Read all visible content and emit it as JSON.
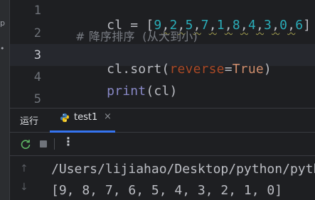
{
  "left_strip": {
    "glyphs": [
      "p",
      "•"
    ]
  },
  "editor": {
    "line_numbers": [
      "1",
      "2",
      "3",
      "4",
      "5"
    ],
    "active_line": "3",
    "lines": {
      "l1_prefix": "cl = [",
      "l1_numbers": [
        "9",
        "2",
        "5",
        "7",
        "1",
        "8",
        "4",
        "3",
        "0",
        "6"
      ],
      "l1_sep": ",",
      "l1_suffix": "]",
      "l2_comment": "# 降序排序  (从大到小)",
      "l3_prefix": "cl.sort(",
      "l3_param": "reverse",
      "l3_eq": "=",
      "l3_value": "True",
      "l3_suffix": ")",
      "l4_builtin": "print",
      "l4_rest": "(cl)"
    }
  },
  "run_panel": {
    "label": "运行",
    "tab_title": "test1",
    "tab_close": "×",
    "more_glyph": "⋮",
    "output": [
      "/Users/lijiahao/Desktop/python/pyth",
      "[9, 8, 7, 6, 5, 4, 3, 2, 1, 0]"
    ]
  }
}
